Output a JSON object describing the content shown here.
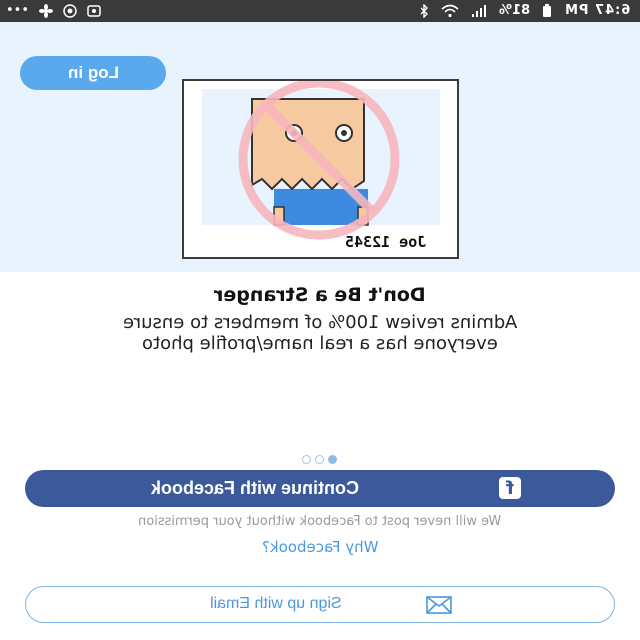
{
  "status_bar": {
    "time": "6:47 PM",
    "battery": "81%",
    "left_icons": [
      "overflow-dots-icon",
      "fan-icon",
      "signal-target-icon",
      "screen-record-icon"
    ],
    "right_icons": [
      "bluetooth-icon",
      "wifi-icon",
      "signal-icon",
      "battery-icon"
    ]
  },
  "hero": {
    "login_label": "Log in",
    "card_name": "Joe 12345"
  },
  "onboarding": {
    "title": "Don't Be a Stranger",
    "subtitle_line1": "Admins review 100% of members to ensure",
    "subtitle_line2": "everyone has a real name/profile photo",
    "pager": {
      "total": 3,
      "active_index": 2
    }
  },
  "facebook": {
    "button_label": "Continue with Facebook",
    "icon_glyph": "f",
    "disclaimer": "We will never post to Facebook without your permission",
    "why_link": "Why Facebook?"
  },
  "email": {
    "button_label": "Sign up with Email"
  },
  "colors": {
    "hero_bg": "#e8f3fd",
    "accent_blue": "#5aa9ee",
    "facebook_blue": "#3c5a9a",
    "link_blue": "#4a98df",
    "ban_red": "#f7b6bd",
    "face_skin": "#f6c9a0",
    "shirt_blue": "#3d8be0"
  }
}
